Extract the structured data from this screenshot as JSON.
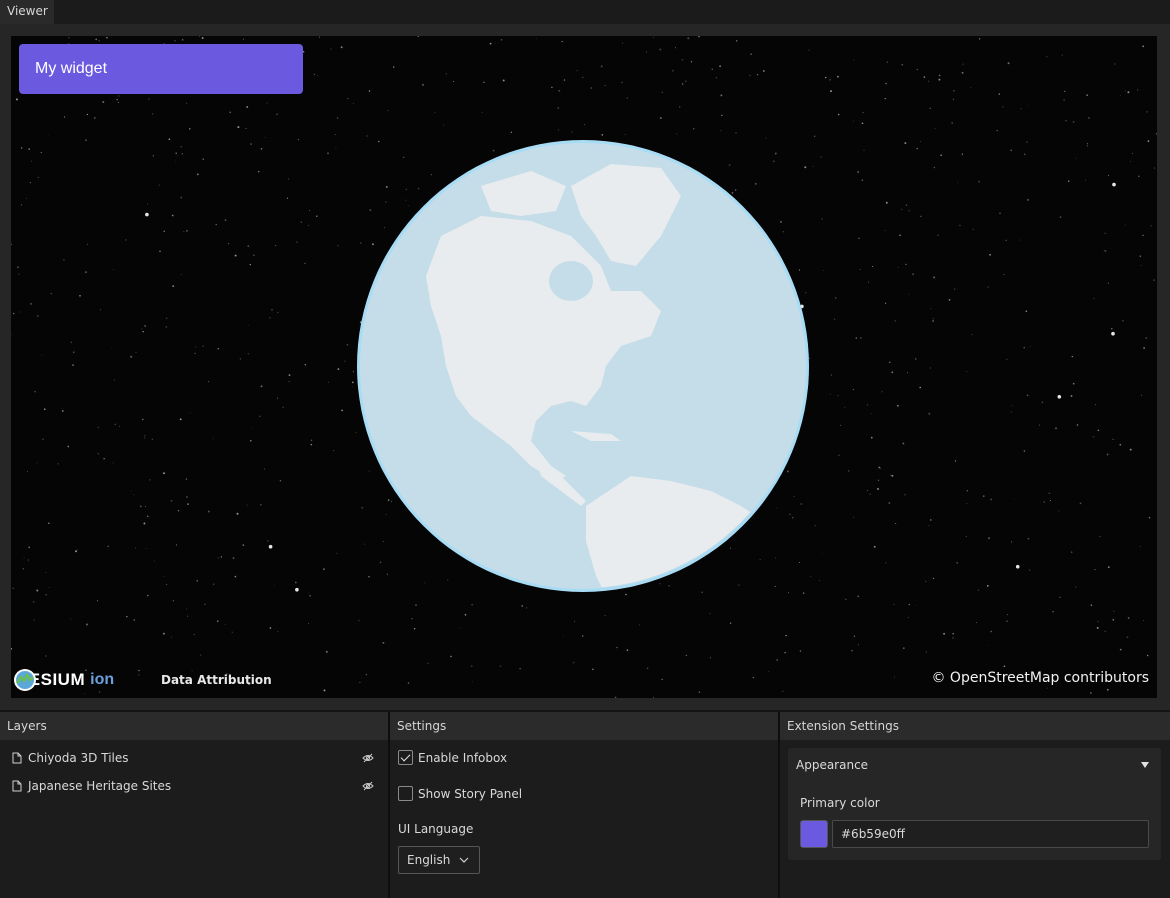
{
  "viewer": {
    "tab_label": "Viewer",
    "widget_title": "My widget",
    "widget_color": "#6b59e0",
    "cesium_logo": {
      "brand": "CESIUM",
      "suffix": "ion"
    },
    "data_attribution": "Data Attribution",
    "credit": "© OpenStreetMap contributors"
  },
  "layers": {
    "title": "Layers",
    "items": [
      {
        "label": "Chiyoda 3D Tiles",
        "icon": "file-icon",
        "visibility_icon": "eye-slash-icon"
      },
      {
        "label": "Japanese Heritage Sites",
        "icon": "file-icon",
        "visibility_icon": "eye-slash-icon"
      }
    ]
  },
  "settings": {
    "title": "Settings",
    "enable_infobox": {
      "label": "Enable Infobox",
      "checked": true
    },
    "show_story_panel": {
      "label": "Show Story Panel",
      "checked": false
    },
    "ui_language": {
      "label": "UI Language",
      "value": "English"
    }
  },
  "extension_settings": {
    "title": "Extension Settings",
    "section": {
      "title": "Appearance",
      "primary_color_label": "Primary color",
      "primary_color_value": "#6b59e0ff",
      "swatch_color": "#6b59e0"
    }
  }
}
